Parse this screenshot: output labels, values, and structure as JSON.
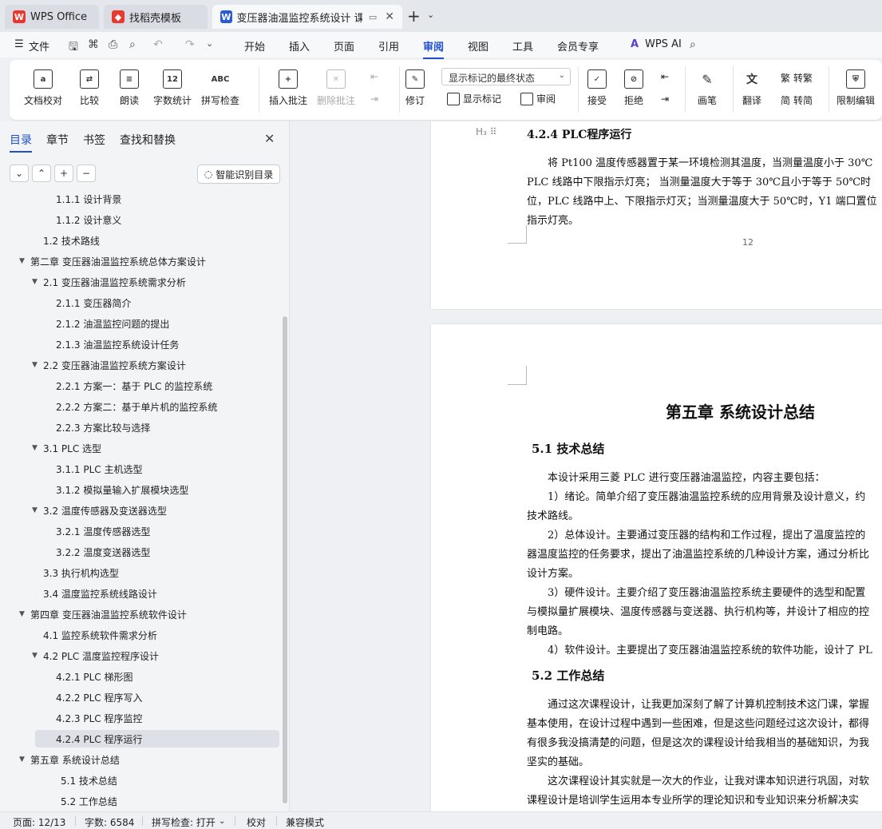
{
  "tabs": [
    {
      "label": "WPS Office",
      "icon": "wps-icon"
    },
    {
      "label": "找稻壳模板",
      "icon": "docer-icon"
    },
    {
      "label": "变压器油温监控系统设计 课程",
      "icon": "writer-icon"
    }
  ],
  "menu": {
    "file": "文件",
    "items": [
      "开始",
      "插入",
      "页面",
      "引用",
      "审阅",
      "视图",
      "工具",
      "会员专享"
    ],
    "active": "审阅",
    "ai": "WPS AI"
  },
  "ribbon": {
    "proofread": "文档校对",
    "compare": "比较",
    "read_aloud": "朗读",
    "word_count": "字数统计",
    "spell_check": "拼写检查",
    "insert_comment": "插入批注",
    "delete_comment": "删除批注",
    "revise": "修订",
    "markup_select": "显示标记的最终状态",
    "show_markup": "显示标记",
    "review": "审阅",
    "accept": "接受",
    "reject": "拒绝",
    "pen": "画笔",
    "translate": "翻译",
    "to_traditional": "转繁",
    "to_simplified": "转简",
    "restrict_edit": "限制编辑",
    "wordcount_icon": "12",
    "spell_icon": "ABC"
  },
  "nav": {
    "tabs": [
      "目录",
      "章节",
      "书签",
      "查找和替换"
    ],
    "active_tab": "目录",
    "smart_toc": "智能识别目录",
    "toc": [
      {
        "label": "1.1.1  设计背景",
        "level": 3,
        "arrow": false
      },
      {
        "label": "1.1.2  设计意义",
        "level": 3,
        "arrow": false
      },
      {
        "label": "1.2  技术路线",
        "level": 2,
        "arrow": false
      },
      {
        "label": "第二章  变压器油温监控系统总体方案设计",
        "level": 1,
        "arrow": true
      },
      {
        "label": "2.1  变压器油温监控系统需求分析",
        "level": 2,
        "arrow": true
      },
      {
        "label": "2.1.1  变压器简介",
        "level": 3,
        "arrow": false
      },
      {
        "label": "2.1.2  油温监控问题的提出",
        "level": 3,
        "arrow": false
      },
      {
        "label": "2.1.3  油温监控系统设计任务",
        "level": 3,
        "arrow": false
      },
      {
        "label": "2.2  变压器油温监控系统方案设计",
        "level": 2,
        "arrow": true
      },
      {
        "label": "2.2.1  方案一：基于 PLC 的监控系统",
        "level": 3,
        "arrow": false
      },
      {
        "label": "2.2.2  方案二：基于单片机的监控系统",
        "level": 3,
        "arrow": false
      },
      {
        "label": "2.2.3  方案比较与选择",
        "level": 3,
        "arrow": false
      },
      {
        "label": "3.1 PLC 选型",
        "level": 2,
        "arrow": true
      },
      {
        "label": "3.1.1 PLC 主机选型",
        "level": 3,
        "arrow": false
      },
      {
        "label": "3.1.2     模拟量输入扩展模块选型",
        "level": 3,
        "arrow": false
      },
      {
        "label": "3.2  温度传感器及变送器选型",
        "level": 2,
        "arrow": true
      },
      {
        "label": "3.2.1  温度传感器选型",
        "level": 3,
        "arrow": false
      },
      {
        "label": "3.2.2  温度变送器选型",
        "level": 3,
        "arrow": false
      },
      {
        "label": "3.3  执行机构选型",
        "level": 2,
        "arrow": false
      },
      {
        "label": "3.4  温度监控系统线路设计",
        "level": 2,
        "arrow": false
      },
      {
        "label": "第四章  变压器油温监控系统软件设计",
        "level": 1,
        "arrow": true
      },
      {
        "label": "4.1  监控系统软件需求分析",
        "level": 2,
        "arrow": false
      },
      {
        "label": "4.2 PLC 温度监控程序设计",
        "level": 2,
        "arrow": true
      },
      {
        "label": "4.2.1     PLC 梯形图",
        "level": 3,
        "arrow": false
      },
      {
        "label": "4.2.2     PLC 程序写入",
        "level": 3,
        "arrow": false
      },
      {
        "label": "4.2.3     PLC 程序监控",
        "level": 3,
        "arrow": false
      },
      {
        "label": "4.2.4     PLC 程序运行",
        "level": 3,
        "arrow": false,
        "selected": true
      },
      {
        "label": "第五章  系统设计总结",
        "level": 1,
        "arrow": true
      },
      {
        "label": "5.1  技术总结",
        "level": 4,
        "arrow": false
      },
      {
        "label": "5.2  工作总结",
        "level": 4,
        "arrow": false
      }
    ]
  },
  "document": {
    "page1": {
      "heading_marker": "H",
      "heading": "4.2.4  PLC程序运行",
      "lines": [
        "将 Pt100 温度传感器置于某一环境检测其温度，当测量温度小于 30℃",
        "PLC 线路中下限指示灯亮；  当测量温度大于等于 30℃且小于等于 50℃时",
        "位，PLC 线路中上、下限指示灯灭；当测量温度大于 50℃时，Y1 端口置位",
        "指示灯亮。"
      ],
      "page_number": "12"
    },
    "page2": {
      "chapter_title": "第五章  系统设计总结",
      "sec1": "5.1 技术总结",
      "sec1_lines": [
        "本设计采用三菱 PLC 进行变压器油温监控，内容主要包括：",
        "1）绪论。简单介绍了变压器油温监控系统的应用背景及设计意义，约",
        "技术路线。",
        "2）总体设计。主要通过变压器的结构和工作过程，提出了温度监控的",
        "器温度监控的任务要求，提出了油温监控系统的几种设计方案，通过分析比",
        "设计方案。",
        "3）硬件设计。主要介绍了变压器油温监控系统主要硬件的选型和配置",
        "与模拟量扩展模块、温度传感器与变送器、执行机构等，并设计了相应的控",
        "制电路。",
        "4）软件设计。主要提出了变压器油温监控系统的软件功能，设计了 PL"
      ],
      "sec2": "5.2 工作总结",
      "sec2_lines": [
        "通过这次课程设计，让我更加深刻了解了计算机控制技术这门课，掌握",
        "基本使用，在设计过程中遇到一些困难，但是这些问题经过这次设计，都得",
        "有很多我没搞清楚的问题，但是这次的课程设计给我相当的基础知识，为我",
        "坚实的基础。",
        "这次课程设计其实就是一次大的作业，让我对课本知识进行巩固，对软",
        "课程设计是培训学生运用本专业所学的理论知识和专业知识来分析解决实"
      ]
    }
  },
  "status": {
    "page": "页面: 12/13",
    "words": "字数: 6584",
    "spell": "拼写检查: 打开",
    "proof": "校对",
    "compat": "兼容模式"
  },
  "colors": {
    "accent": "#1f4fd1",
    "wps_red": "#e8382f",
    "writer_blue": "#2a5bd7"
  }
}
